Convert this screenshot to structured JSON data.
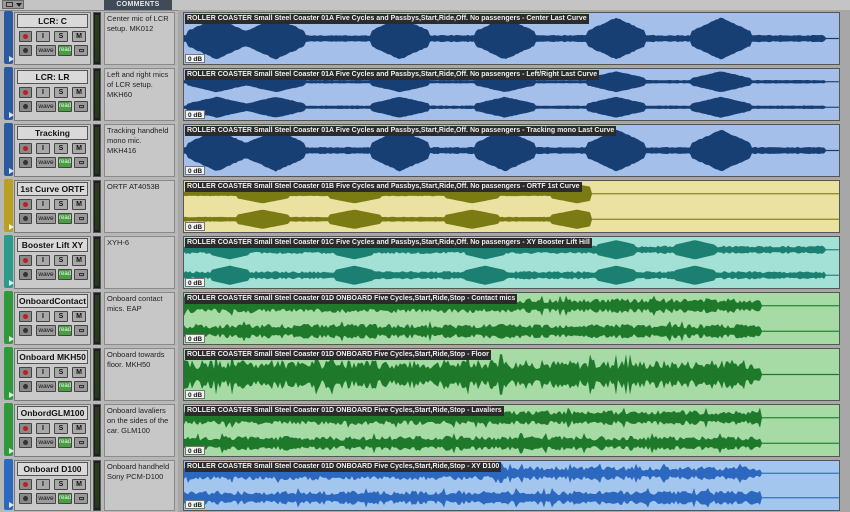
{
  "header": {
    "comments_label": "COMMENTS"
  },
  "tracks": [
    {
      "name": "LCR: C",
      "comment": "Center mic of LCR setup. MK012",
      "clip": "ROLLER COASTER Small Steel Coaster 01A Five Cycles and Passbys,Start,Ride,Off. No passengers - Center Last Curve",
      "gain": "0 dB",
      "color": "#2c5aa0",
      "bg": "#a4c0ea",
      "wave": "#173f74",
      "channels": 1
    },
    {
      "name": "LCR: LR",
      "comment": "Left and right mics of LCR setup. MKH60",
      "clip": "ROLLER COASTER Small Steel Coaster 01A Five Cycles and Passbys,Start,Ride,Off. No passengers - Left/Right Last Curve",
      "gain": "0 dB",
      "color": "#2c5aa0",
      "bg": "#a4c0ea",
      "wave": "#173f74",
      "channels": 2
    },
    {
      "name": "Tracking",
      "comment": "Tracking handheld mono mic. MKH416",
      "clip": "ROLLER COASTER Small Steel Coaster 01A Five Cycles and Passbys,Start,Ride,Off. No passengers - Tracking mono Last Curve",
      "gain": "0 dB",
      "color": "#2c5aa0",
      "bg": "#a4c0ea",
      "wave": "#173f74",
      "channels": 1
    },
    {
      "name": "1st Curve ORTF",
      "comment": "ORTF AT4053B",
      "clip": "ROLLER COASTER Small Steel Coaster 01B Five Cycles and Passbys,Start,Ride,Off. No passengers - ORTF 1st Curve",
      "gain": "0 dB",
      "color": "#b9a020",
      "bg": "#ebe2a2",
      "wave": "#7b7b14",
      "channels": 2
    },
    {
      "name": "Booster Lift XY",
      "comment": "XYH-6",
      "clip": "ROLLER COASTER Small Steel Coaster 01C Five Cycles and Passbys,Start,Ride,Off. No passengers - XY Booster Lift Hill",
      "gain": "0 dB",
      "color": "#2a9a8a",
      "bg": "#a3e0d6",
      "wave": "#1b8071",
      "channels": 2
    },
    {
      "name": "OnboardContact",
      "comment": "Onboard contact mics. EAP",
      "clip": "ROLLER COASTER Small Steel Coaster 01D ONBOARD Five Cycles,Start,Ride,Stop - Contact mics",
      "gain": "0 dB",
      "color": "#2e9a3c",
      "bg": "#a6dba6",
      "wave": "#1e7a2a",
      "channels": 2
    },
    {
      "name": "Onboard MKH50",
      "comment": "Onboard towards floor. MKH50",
      "clip": "ROLLER COASTER Small Steel Coaster 01D ONBOARD Five Cycles,Start,Ride,Stop - Floor",
      "gain": "0 dB",
      "color": "#2e9a3c",
      "bg": "#a6dba6",
      "wave": "#1e7a2a",
      "channels": 1
    },
    {
      "name": "OnbordGLM100",
      "comment": "Onboard lavaliers on the sides of the car. GLM100",
      "clip": "ROLLER COASTER Small Steel Coaster 01D ONBOARD Five Cycles,Start,Ride,Stop - Lavaliers",
      "gain": "0 dB",
      "color": "#2e9a3c",
      "bg": "#a6dba6",
      "wave": "#1e7a2a",
      "channels": 2
    },
    {
      "name": "Onboard D100",
      "comment": "Onboard handheld Sony PCM-D100",
      "clip": "ROLLER COASTER Small Steel Coaster 01D ONBOARD Five Cycles,Start,Ride,Stop - XY D100",
      "gain": "0 dB",
      "color": "#2c6ac0",
      "bg": "#a2c6ee",
      "wave": "#2c68c0",
      "channels": 2
    }
  ],
  "buttons": {
    "input": "I",
    "solo": "S",
    "mute": "M",
    "view": "wave",
    "automation": "read"
  }
}
